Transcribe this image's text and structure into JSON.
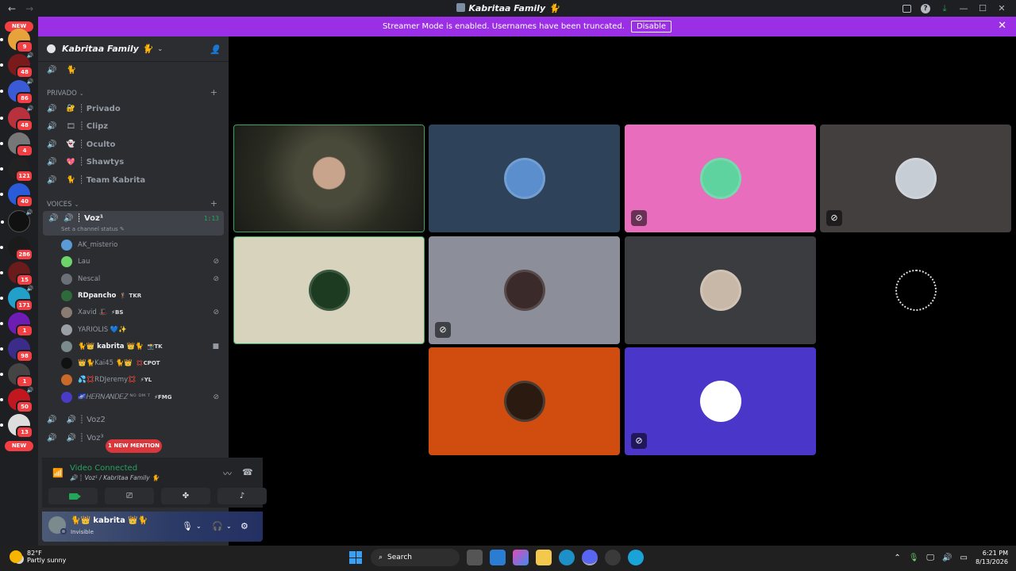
{
  "window": {
    "title": "Kabritaa Family 🐈",
    "nav_back": "←",
    "nav_forward": "→"
  },
  "banner": {
    "message": "Streamer Mode is enabled. Usernames have been truncated.",
    "button": "Disable",
    "close": "✕"
  },
  "guilds": {
    "top_pill": "NEW",
    "bottom_pill": "NEW",
    "badges": [
      "9",
      "48",
      "86",
      "48",
      "4",
      "121",
      "40",
      "",
      "286",
      "15",
      "171",
      "1",
      "98",
      "1",
      "50",
      "13"
    ]
  },
  "server": {
    "name": "Kabritaa Family 🐈",
    "chevron": "⌄"
  },
  "channels": {
    "top_channel": "🐈",
    "private_category": "PRIVADO",
    "private": [
      {
        "emoji": "🔐",
        "name": "Privado"
      },
      {
        "emoji": "🎞",
        "name": "Clipz"
      },
      {
        "emoji": "👻",
        "name": "Oculto"
      },
      {
        "emoji": "💖",
        "name": "Shawtys"
      },
      {
        "emoji": "🐈",
        "name": "Team Kabrita"
      }
    ],
    "voices_category": "VOICES",
    "active": {
      "name": "┊ Voz¹",
      "status": "Set a channel status",
      "timer": "1:13"
    },
    "voice2": "┊ Voz2",
    "voice3": "┊ Voz³",
    "new_mention": "1 NEW MENTION"
  },
  "voice_users": [
    {
      "name": "AK_misterio",
      "tag": "",
      "color": "#5b9bd5"
    },
    {
      "name": "Lau",
      "tag": "",
      "color": "#6dd36b"
    },
    {
      "name": "Nescal",
      "tag": "",
      "color": "#6b6f78"
    },
    {
      "name": "RDpancho",
      "tag": "🏌 TKR",
      "color": "#2f6b3a"
    },
    {
      "name": "Xavid 🎩",
      "tag": "⚡BS",
      "color": "#8a7c72"
    },
    {
      "name": "YARIOLIS 💙✨",
      "tag": "",
      "color": "#9aa0a6"
    },
    {
      "name": "🐈👑 kabrita 👑🐈",
      "tag": "📸TK",
      "color": "#7b8a8c"
    },
    {
      "name": "👑🐈Kai45 🐈👑",
      "tag": "💢CPOT",
      "color": "#111111"
    },
    {
      "name": "💦💢RDJeremy💢",
      "tag": "⚡YL",
      "color": "#c96a2b"
    },
    {
      "name": "🌌𝐻𝐸𝑅𝑁𝐴𝑁𝐷𝐸𝑍 ᴺᴼ ᴰᴹ ᵀ",
      "tag": "⚡FMG",
      "color": "#4a3bc6"
    }
  ],
  "rtc": {
    "title": "Video Connected",
    "subtitle": "🔊 ┊ Voz¹ / Kabritaa Family 🐈"
  },
  "user_panel": {
    "name": "🐈👑 kabrita 👑🐈",
    "status": "Invisible"
  },
  "tiles": [
    {
      "bg": "#3b3a2e",
      "speaking": true,
      "muted": false
    },
    {
      "bg": "#2e4259",
      "speaking": false,
      "muted": false
    },
    {
      "bg": "#e86ebd",
      "speaking": false,
      "muted": true
    },
    {
      "bg": "#433f3f",
      "speaking": false,
      "muted": true
    },
    {
      "bg": "#d8d3bd",
      "speaking": true,
      "muted": false
    },
    {
      "bg": "#8c8f99",
      "speaking": false,
      "muted": true
    },
    {
      "bg": "#3a3c3f",
      "speaking": false,
      "muted": false
    },
    {
      "bg": "#000000",
      "speaking": false,
      "muted": false
    },
    {
      "bg": "#d14d0f",
      "speaking": false,
      "muted": false
    },
    {
      "bg": "#4a37c9",
      "speaking": false,
      "muted": true
    }
  ],
  "taskbar": {
    "temp": "82°F",
    "weather": "Partly sunny",
    "search": "Search",
    "time": "6:21 PM",
    "date": "8/13/2026"
  }
}
